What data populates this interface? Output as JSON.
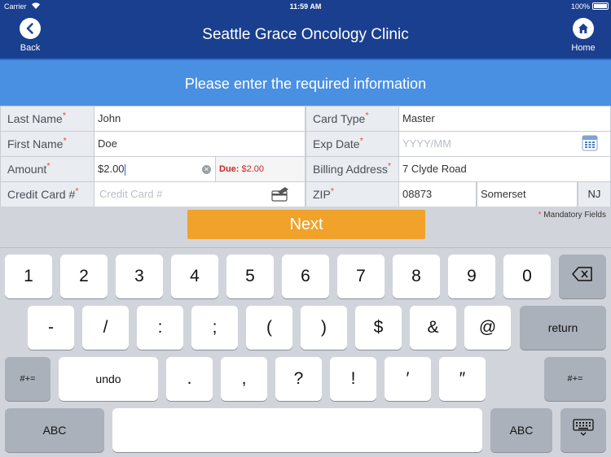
{
  "status": {
    "carrier": "Carrier",
    "time": "11:59 AM",
    "battery": "100%"
  },
  "nav": {
    "back_label": "Back",
    "title": "Seattle Grace Oncology Clinic",
    "home_label": "Home"
  },
  "banner": {
    "text": "Please enter the required information"
  },
  "form": {
    "required_mark": "*",
    "last_name": {
      "label": "Last Name",
      "value": "John"
    },
    "first_name": {
      "label": "First Name",
      "value": "Doe"
    },
    "amount": {
      "label": "Amount",
      "value": "$2.00",
      "due_label": "Due:",
      "due_value": "$2.00"
    },
    "credit_card": {
      "label": "Credit Card #",
      "placeholder": "Credit Card #"
    },
    "card_type": {
      "label": "Card Type",
      "value": "Master"
    },
    "exp_date": {
      "label": "Exp Date",
      "placeholder": "YYYY/MM",
      "calendar_label": "Date"
    },
    "billing_address": {
      "label": "Billing Address",
      "value": "7 Clyde Road"
    },
    "zip": {
      "label": "ZIP",
      "value": "08873",
      "city": "Somerset",
      "state": "NJ"
    },
    "mandatory_note": "Mandatory Fields",
    "next_label": "Next"
  },
  "keyboard": {
    "row1": [
      "1",
      "2",
      "3",
      "4",
      "5",
      "6",
      "7",
      "8",
      "9",
      "0"
    ],
    "row2": [
      "-",
      "/",
      ":",
      ";",
      "(",
      ")",
      "$",
      "&",
      "@"
    ],
    "return_label": "return",
    "row3": [
      "undo",
      ".",
      ",",
      "?",
      "!",
      "′",
      "″"
    ],
    "shift_label": "#+=",
    "abc_label": "ABC"
  },
  "colors": {
    "nav": "#1a3f8f",
    "banner": "#4a90e2",
    "next_button": "#f0a22a",
    "required": "#e05555",
    "due": "#c62828"
  }
}
